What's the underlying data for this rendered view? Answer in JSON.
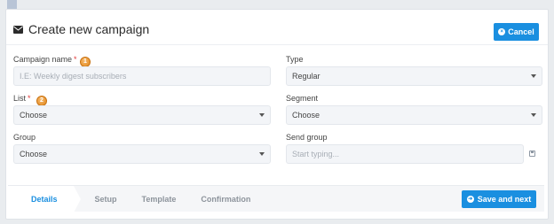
{
  "header": {
    "title": "Create new campaign",
    "icon": "envelope-icon",
    "cancel_label": "Cancel"
  },
  "form": {
    "campaign_name": {
      "label": "Campaign name",
      "required": "*",
      "placeholder": "I.E: Weekly digest subscribers",
      "badge": "1"
    },
    "type": {
      "label": "Type",
      "value": "Regular"
    },
    "list": {
      "label": "List",
      "required": "*",
      "value": "Choose",
      "badge": "2"
    },
    "segment": {
      "label": "Segment",
      "value": "Choose"
    },
    "group": {
      "label": "Group",
      "value": "Choose"
    },
    "send_group": {
      "label": "Send group",
      "placeholder": "Start typing..."
    }
  },
  "footer": {
    "steps": [
      "Details",
      "Setup",
      "Template",
      "Confirmation"
    ],
    "active_step": "Details",
    "save_next_label": "Save and next"
  },
  "colors": {
    "accent": "#1a8fe0",
    "badge": "#e0871c",
    "required": "#e23b3b"
  }
}
